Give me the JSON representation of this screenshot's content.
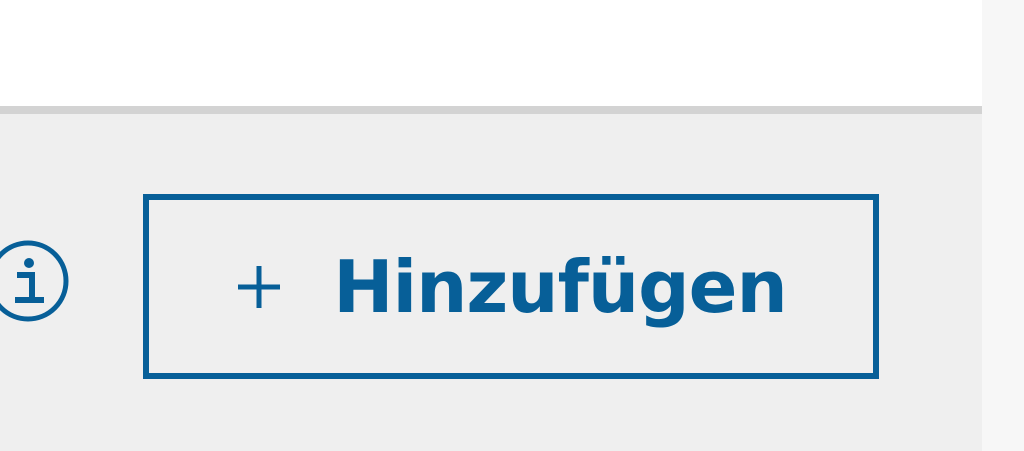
{
  "toolbar": {
    "info_icon": "info-icon",
    "add_button": {
      "icon": "plus-icon",
      "label": "Hinzufügen"
    }
  },
  "colors": {
    "accent": "#075f98",
    "toolbar_background": "#efefef",
    "divider": "#d3d3d3",
    "page_background": "#ffffff",
    "right_gutter": "#f7f7f7"
  }
}
